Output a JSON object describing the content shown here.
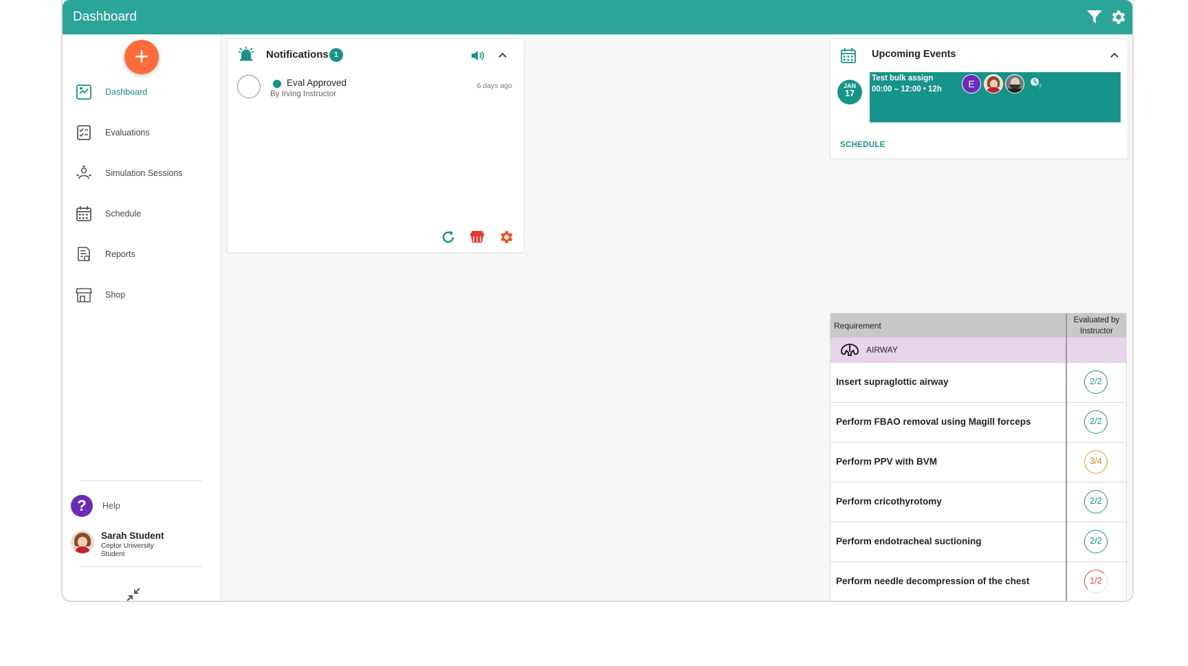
{
  "header": {
    "title": "Dashboard",
    "filter_icon": "filter-icon",
    "settings_icon": "gear-icon",
    "color": "#2aa597"
  },
  "sidebar": {
    "fab_label": "+",
    "items": [
      {
        "label": "Dashboard",
        "icon": "dashboard-icon",
        "active": true
      },
      {
        "label": "Evaluations",
        "icon": "evaluations-icon"
      },
      {
        "label": "Simulation Sessions",
        "icon": "simulation-icon"
      },
      {
        "label": "Schedule",
        "icon": "calendar-icon"
      },
      {
        "label": "Reports",
        "icon": "reports-icon"
      },
      {
        "label": "Shop",
        "icon": "shop-icon"
      }
    ],
    "help_label": "Help",
    "help_icon_text": "?",
    "user": {
      "name": "Sarah Student",
      "org": "Ceptor University",
      "role": "Student"
    }
  },
  "notifications": {
    "title": "Notifications",
    "count": "1",
    "items": [
      {
        "title": "Eval Approved",
        "by": "By Irving Instructor",
        "time": "6 days ago"
      }
    ]
  },
  "events": {
    "title": "Upcoming Events",
    "date": {
      "month": "JAN",
      "day": "17"
    },
    "event": {
      "title": "Test bulk assign",
      "time": "00:00 – 12:00 • 12h",
      "avatar_initial": "E"
    },
    "schedule_link": "SCHEDULE"
  },
  "requirements": {
    "col_requirement": "Requirement",
    "col_evaluated": "Evaluated by Instructor",
    "category": "AIRWAY",
    "rows": [
      {
        "label": "Insert supraglottic airway",
        "score": "2/2",
        "status": "complete"
      },
      {
        "label": "Perform FBAO removal using Magill forceps",
        "score": "2/2",
        "status": "complete"
      },
      {
        "label": "Perform PPV with BVM",
        "score": "3/4",
        "status": "partial"
      },
      {
        "label": "Perform cricothyrotomy",
        "score": "2/2",
        "status": "complete"
      },
      {
        "label": "Perform endotracheal suctioning",
        "score": "2/2",
        "status": "complete"
      },
      {
        "label": "Perform needle decompression of the chest",
        "score": "1/2",
        "status": "low"
      }
    ]
  },
  "colors": {
    "teal": "#16948a",
    "orange": "#ff6b39",
    "purple": "#6c2bb7",
    "category_bg": "#e9d3ec"
  }
}
